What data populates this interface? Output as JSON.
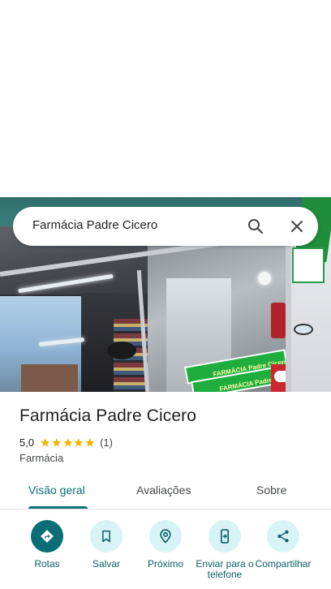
{
  "search": {
    "query": "Farmácia Padre Cicero"
  },
  "place": {
    "name": "Farmácia Padre Cicero",
    "rating": "5,0",
    "stars": 5,
    "review_count": "(1)",
    "category": "Farmácia"
  },
  "photo": {
    "sign_text_1": "FARMÁCIA Padre Cícero",
    "sign_text_2": "FARMÁCIA Padre Cícero",
    "red_label": "elip's"
  },
  "tabs": [
    {
      "label": "Visão geral",
      "selected": true
    },
    {
      "label": "Avaliações",
      "selected": false
    },
    {
      "label": "Sobre",
      "selected": false
    }
  ],
  "actions": [
    {
      "label": "Rotas",
      "icon": "directions-icon"
    },
    {
      "label": "Salvar",
      "icon": "bookmark-icon"
    },
    {
      "label": "Próximo",
      "icon": "nearby-icon"
    },
    {
      "label": "Enviar para o telefone",
      "icon": "send-to-phone-icon"
    },
    {
      "label": "Compartilhar",
      "icon": "share-icon"
    }
  ],
  "colors": {
    "accent": "#0b6e77",
    "action_bg": "#d8f3f6",
    "star": "#f5b400"
  }
}
